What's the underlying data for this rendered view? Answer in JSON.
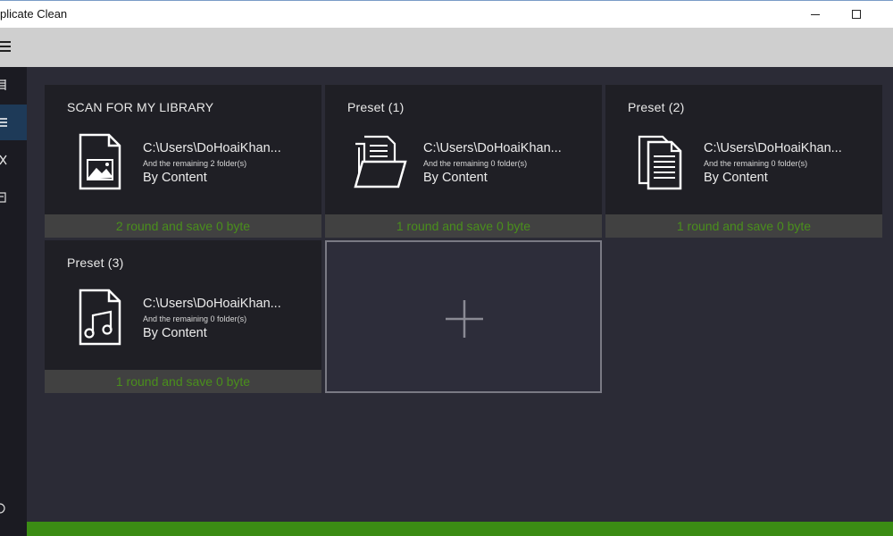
{
  "window": {
    "title": "plicate Clean"
  },
  "colors": {
    "accent_green": "#3b8c14",
    "footer_text_green": "#4a8f1c",
    "active_sidebar": "#1e3a58"
  },
  "sidebar": {
    "items": [
      {
        "icon": "library-icon"
      },
      {
        "icon": "list-icon"
      },
      {
        "icon": "close-x-icon"
      },
      {
        "icon": "document-icon"
      },
      {
        "icon": "settings-icon"
      }
    ]
  },
  "cards": [
    {
      "title": "SCAN FOR MY LIBRARY",
      "icon": "image-file-icon",
      "path": "C:\\Users\\DoHoaiKhan...",
      "remaining": "And the remaining 2 folder(s)",
      "mode": "By Content",
      "footer": "2 round and save 0 byte"
    },
    {
      "title": "Preset (1)",
      "icon": "open-folder-icon",
      "path": "C:\\Users\\DoHoaiKhan...",
      "remaining": "And the remaining 0 folder(s)",
      "mode": "By Content",
      "footer": "1 round and save 0 byte"
    },
    {
      "title": "Preset (2)",
      "icon": "text-documents-icon",
      "path": "C:\\Users\\DoHoaiKhan...",
      "remaining": "And the remaining 0 folder(s)",
      "mode": "By Content",
      "footer": "1 round and save 0 byte"
    },
    {
      "title": "Preset (3)",
      "icon": "music-file-icon",
      "path": "C:\\Users\\DoHoaiKhan...",
      "remaining": "And the remaining 0 folder(s)",
      "mode": "By Content",
      "footer": "1 round and save 0 byte"
    }
  ],
  "add_card": {
    "icon": "plus-icon"
  }
}
